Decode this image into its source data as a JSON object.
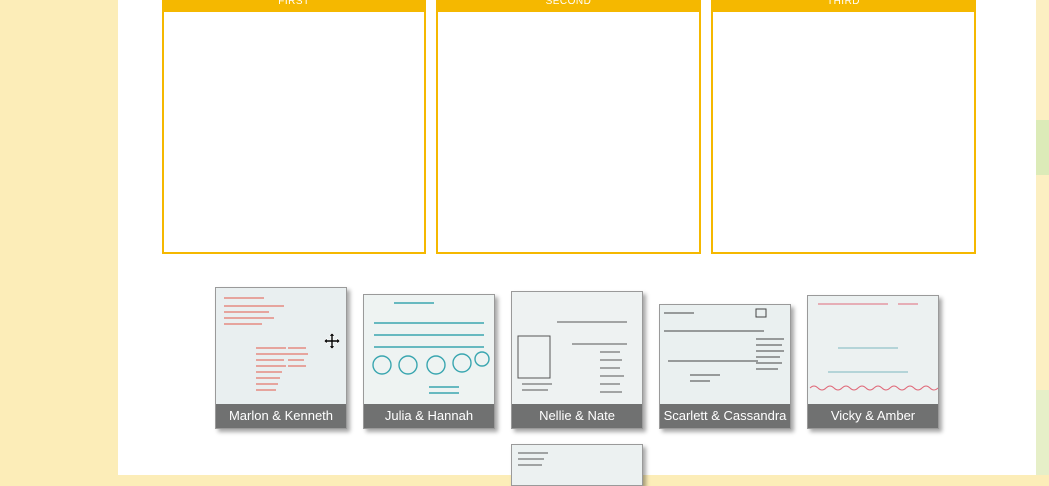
{
  "bins": [
    {
      "label": "FIRST"
    },
    {
      "label": "SECOND"
    },
    {
      "label": "THIRD"
    }
  ],
  "cards": [
    {
      "caption": "Marlon & Kenneth",
      "ink": "#e45a4a"
    },
    {
      "caption": "Julia & Hannah",
      "ink": "#3aa6b0"
    },
    {
      "caption": "Nellie & Nate",
      "ink": "#444444"
    },
    {
      "caption": "Scarlett & Cassandra",
      "ink": "#333333"
    },
    {
      "caption": "Vicky & Amber",
      "ink": "#e06a7a"
    }
  ],
  "cursor": {
    "icon": "move-cursor-icon"
  }
}
